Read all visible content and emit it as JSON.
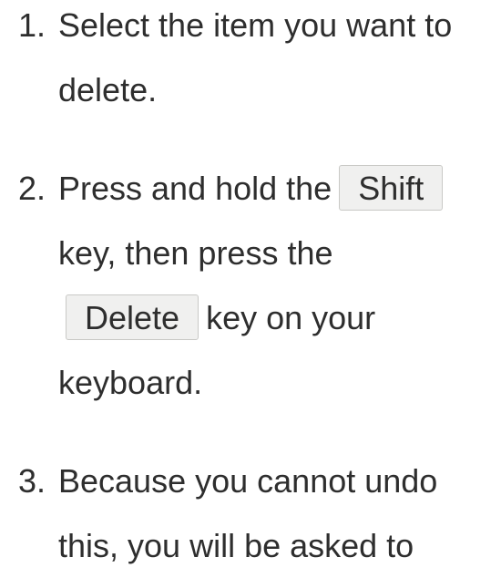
{
  "steps": [
    {
      "number": "1.",
      "text": "Select the item you want to delete."
    },
    {
      "number": "2.",
      "before_shift": "Press and hold the",
      "shift_key": "Shift",
      "after_shift": "key, then press the",
      "delete_key": "Delete",
      "after_delete": "key on your keyboard."
    },
    {
      "number": "3.",
      "text": "Because you cannot undo this, you will be asked to"
    }
  ]
}
